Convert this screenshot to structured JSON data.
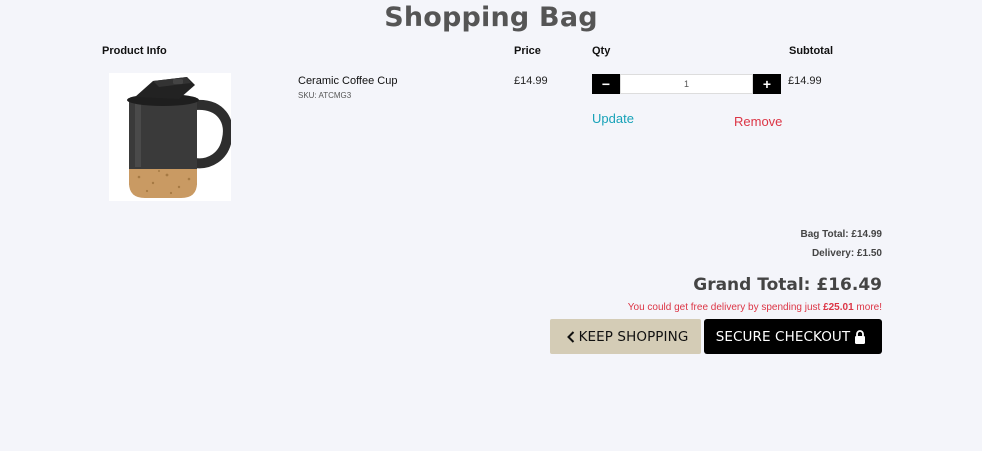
{
  "page": {
    "title": "Shopping Bag"
  },
  "table": {
    "headers": {
      "product": "Product Info",
      "price": "Price",
      "qty": "Qty",
      "subtotal": "Subtotal"
    }
  },
  "item": {
    "name": "Ceramic Coffee Cup",
    "sku": "SKU: ATCMG3",
    "price": "£14.99",
    "quantity": "1",
    "subtotal": "£14.99",
    "decrement_label": "−",
    "increment_label": "+",
    "update_label": "Update",
    "remove_label": "Remove",
    "image_icon": "mug-photo"
  },
  "totals": {
    "bag_total": "Bag Total: £14.99",
    "delivery": "Delivery: £1.50",
    "grand_total": "Grand Total: £16.49",
    "free_delivery_prefix": "You could get free delivery by spending just ",
    "free_delivery_amount": "£25.01",
    "free_delivery_suffix": " more!"
  },
  "actions": {
    "keep_shopping_label": "KEEP SHOPPING",
    "checkout_label": "SECURE CHECKOUT"
  },
  "colors": {
    "background": "#f4f5fa",
    "update": "#17a2b8",
    "remove": "#dc3545",
    "keep_button": "#d4ccb6",
    "checkout_button": "#000000"
  }
}
